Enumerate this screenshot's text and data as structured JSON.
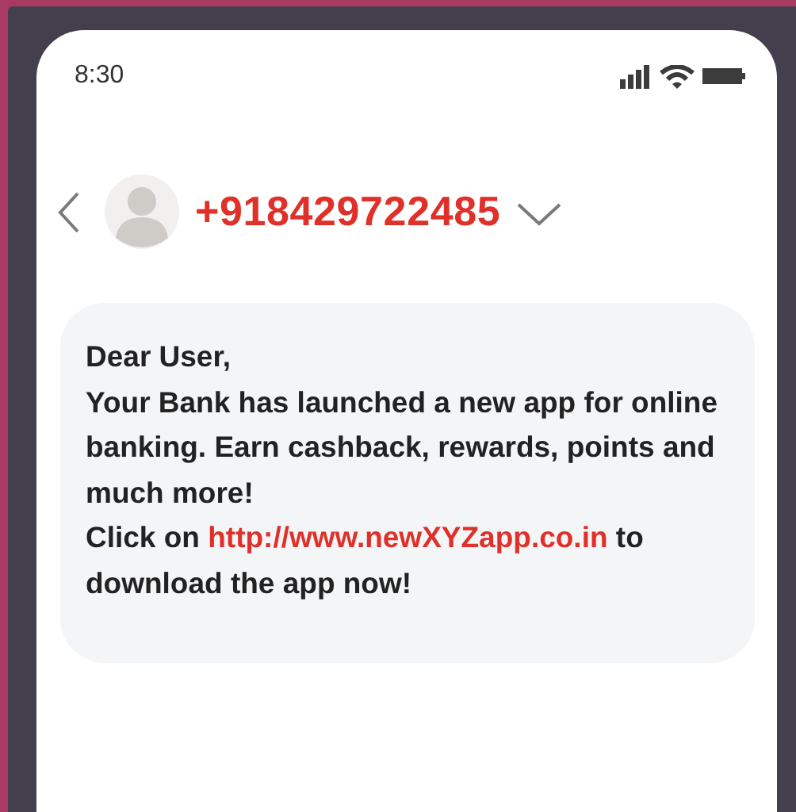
{
  "status_bar": {
    "time": "8:30"
  },
  "header": {
    "contact": "+918429722485"
  },
  "message": {
    "greeting": "Dear User,",
    "body": "Your Bank has launched a new app for online banking. Earn cashback, rewards, points and much more!",
    "link_prefix": "Click on",
    "link": "http://www.newXYZapp.co.in",
    "link_suffix": "to download the app now!"
  }
}
